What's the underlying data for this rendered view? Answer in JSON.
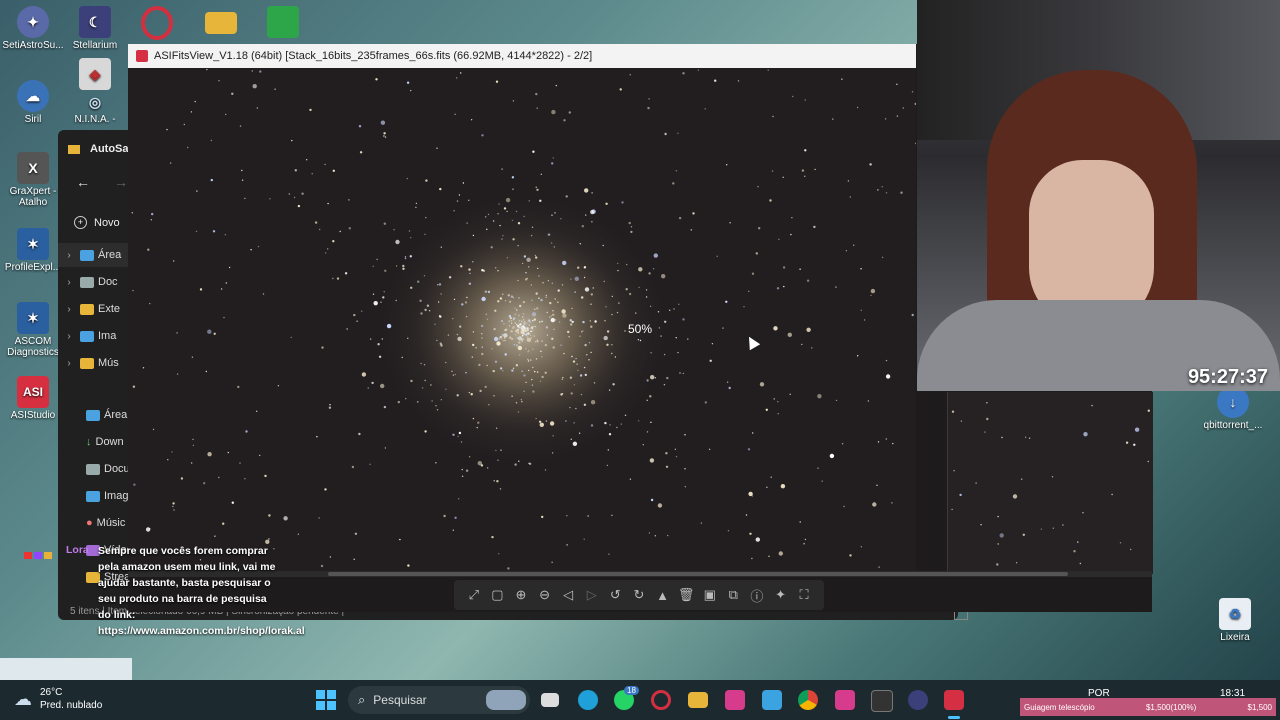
{
  "desktop": {
    "icons": [
      {
        "label": "SetiAstroSu...",
        "color": "#5a6aa8"
      },
      {
        "label": "Stellarium",
        "color": "#3b3f7a"
      },
      {
        "label": "",
        "color": "#d23040"
      },
      {
        "label": "",
        "color": "#e6b53a"
      },
      {
        "label": "",
        "color": "#2da64a"
      },
      {
        "label": "Siril",
        "color": "#3a72b8"
      },
      {
        "label": "N.I.N.A. -",
        "color": "#c0c0c0"
      },
      {
        "label": "GraXpert - Atalho",
        "color": "#555555"
      },
      {
        "label": "ProfileExpl...",
        "color": "#2a5fa0"
      },
      {
        "label": "ASCOM Diagnostics",
        "color": "#2a5fa0"
      },
      {
        "label": "ASIStudio",
        "color": "#d63040"
      },
      {
        "label": "qbittorrent_...",
        "color": "#3b78c4"
      },
      {
        "label": "Lixeira",
        "color": "#7fa8c8"
      }
    ],
    "asi_logo_text": "ASI"
  },
  "explorer": {
    "tab_title": "AutoSa",
    "new_button": "Novo",
    "tree": [
      "Área",
      "Doc",
      "Exte",
      "Ima",
      "Mús"
    ],
    "quick": [
      "Área",
      "Down",
      "Docu",
      "Image",
      "Músic",
      "Vídeo",
      "Strea"
    ],
    "status_items": "5 itens",
    "status_selected": "Item selecionado  66,9 MB",
    "status_sync": "Sincronização pendente"
  },
  "fits": {
    "title": "ASIFitsView_V1.18 (64bit) [Stack_16bits_235frames_66s.fits (66.92MB, 4144*2822) - 2/2]",
    "zoom": "50%"
  },
  "webcam": {
    "timer": "95:27:37"
  },
  "chat": {
    "user": "Lora",
    "message": "Sempre que vocês forem comprar pela amazon usem meu link, vai me ajudar bastante, basta pesquisar o seu produto na barra de pesquisa do link: https://www.amazon.com.br/shop/lorak.al"
  },
  "taskbar": {
    "weather_temp": "26°C",
    "weather_desc": "Pred. nublado",
    "search_placeholder": "Pesquisar",
    "whatsapp_badge": "18",
    "lang": "POR",
    "time": "18:31",
    "guiding_label": "Guiagem telescópio",
    "guiding_value": "$1,500(100%)",
    "guiding_value2": "$1,500"
  }
}
